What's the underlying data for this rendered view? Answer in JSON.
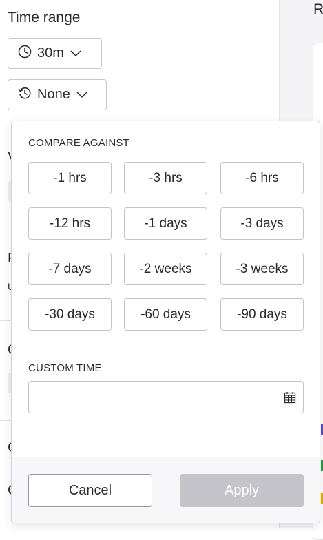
{
  "time_range": {
    "title": "Time range",
    "range_button_label": "30m",
    "compare_button_label": "None"
  },
  "right_panel": {
    "letter": "R"
  },
  "background_peeks": [
    "V",
    "F",
    "C",
    "C",
    "G",
    "C",
    "Unit"
  ],
  "popover": {
    "compare_label": "COMPARE AGAINST",
    "options": [
      "-1 hrs",
      "-3 hrs",
      "-6 hrs",
      "-12 hrs",
      "-1 days",
      "-3 days",
      "-7 days",
      "-2 weeks",
      "-3 weeks",
      "-30 days",
      "-60 days",
      "-90 days"
    ],
    "custom_label": "CUSTOM TIME",
    "custom_value": "",
    "cancel_label": "Cancel",
    "apply_label": "Apply"
  },
  "colors": {
    "apply_disabled": "#c4c4ca",
    "border": "#c3c3cb",
    "text": "#2b2b33",
    "strip_purple": "#5b4fd1",
    "strip_green": "#2f9a4a",
    "strip_yellow": "#e8b400"
  }
}
